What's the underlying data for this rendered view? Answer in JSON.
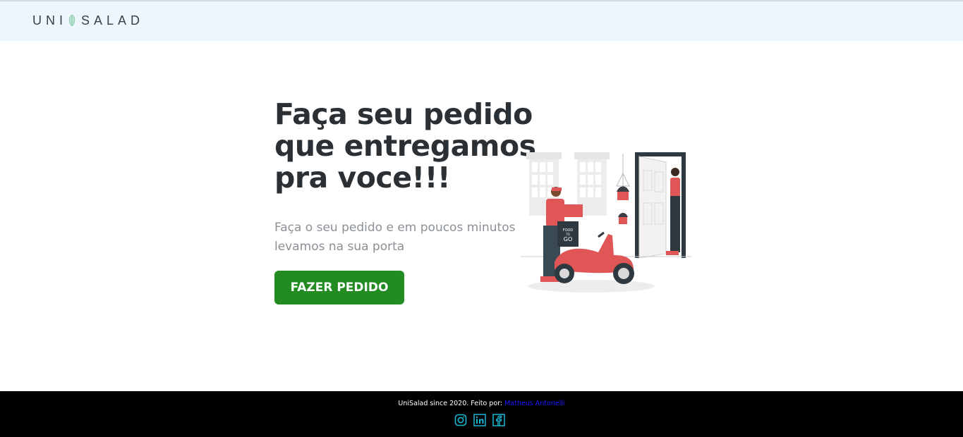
{
  "header": {
    "logo_text": "UNISALAD",
    "logo_before": "UNI",
    "logo_after": "SALAD"
  },
  "hero": {
    "title": "Faça seu pedido que entregamos pra voce!!!",
    "subtitle": "Faça o seu pedido e em poucos minutos levamos na sua porta",
    "cta_label": "FAZER PEDIDO",
    "illustration_sign_top": "FOOD",
    "illustration_sign_mid": "TO",
    "illustration_sign_bottom": "GO"
  },
  "footer": {
    "credit_text": "UniSalad since 2020. Feito por: ",
    "author": "Matheus Antonelli",
    "social_icons": [
      "instagram-icon",
      "linkedin-icon",
      "facebook-icon"
    ]
  },
  "colors": {
    "header_bg": "#eef6fd",
    "cta_green": "#228b22",
    "accent_red": "#e05555",
    "footer_bg": "#000000",
    "social_cyan": "#19b8d4",
    "link_blue": "#1a1aff"
  }
}
